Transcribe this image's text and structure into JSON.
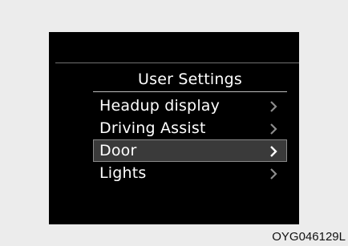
{
  "settings": {
    "title": "User Settings",
    "items": [
      {
        "label": "Headup display",
        "selected": false
      },
      {
        "label": "Driving Assist",
        "selected": false
      },
      {
        "label": "Door",
        "selected": true
      },
      {
        "label": "Lights",
        "selected": false
      }
    ]
  },
  "colors": {
    "page_background": "#ececec",
    "screen_background": "#000000",
    "text": "#ffffff",
    "chevron_inactive": "#8c8c8c",
    "chevron_active": "#ffffff",
    "selection_fill": "#3a3a3a",
    "selection_border": "#8a8a8a"
  },
  "icons": {
    "item_chevron": "chevron-right-icon"
  },
  "caption": "OYG046129L"
}
